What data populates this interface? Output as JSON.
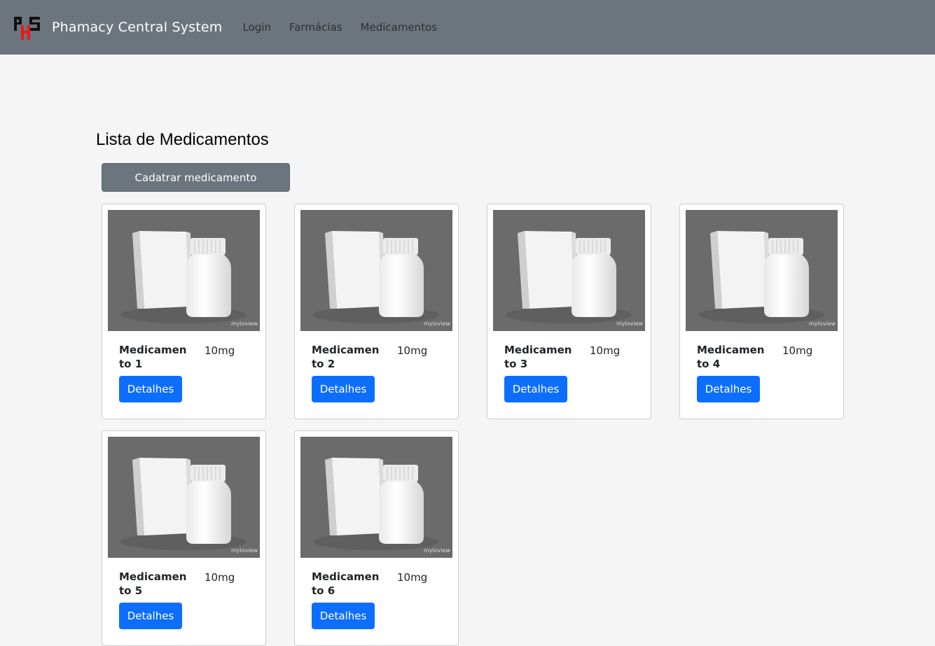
{
  "navbar": {
    "logo_text": "PHS",
    "brand": "Phamacy Central System",
    "links": [
      "Login",
      "Farmácias",
      "Medicamentos"
    ]
  },
  "main": {
    "title": "Lista de Medicamentos",
    "register_button": "Cadatrar medicamento"
  },
  "image_watermark": "myloview",
  "medications": [
    {
      "name": "Medicamento 1",
      "dose": "10mg",
      "button": "Detalhes"
    },
    {
      "name": "Medicamento 2",
      "dose": "10mg",
      "button": "Detalhes"
    },
    {
      "name": "Medicamento 3",
      "dose": "10mg",
      "button": "Detalhes"
    },
    {
      "name": "Medicamento 4",
      "dose": "10mg",
      "button": "Detalhes"
    },
    {
      "name": "Medicamento 5",
      "dose": "10mg",
      "button": "Detalhes"
    },
    {
      "name": "Medicamento 6",
      "dose": "10mg",
      "button": "Detalhes"
    }
  ],
  "colors": {
    "navbar": "#6c757d",
    "primary_button": "#0d6efd",
    "secondary_button": "#6c757d",
    "page_background": "#f5f5f5",
    "logo_red": "#e01b1b"
  }
}
